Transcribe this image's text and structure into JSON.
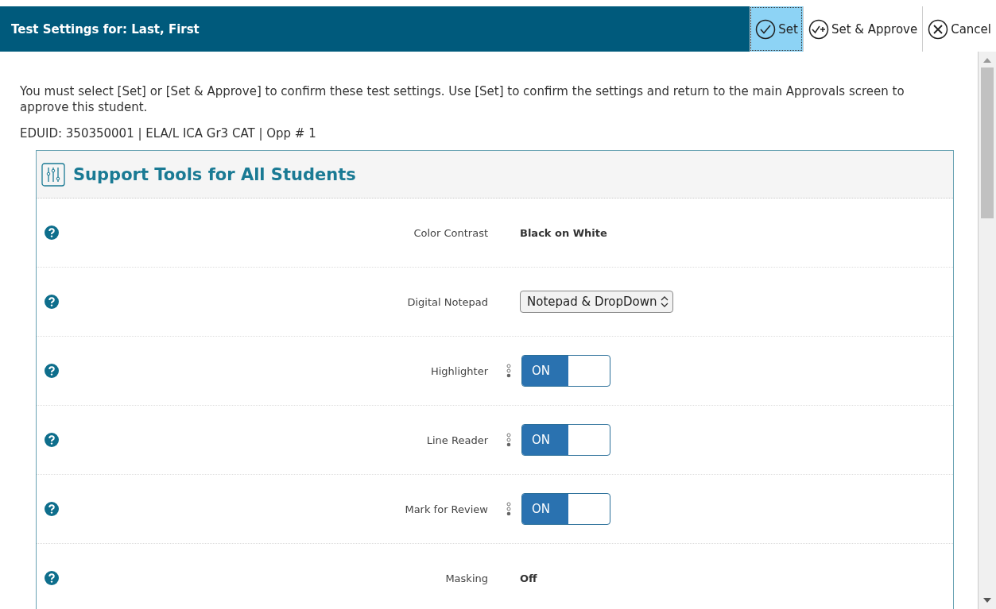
{
  "dialog": {
    "title": "Test Settings for: Last, First",
    "buttons": [
      {
        "kind": "check",
        "label": "Set",
        "selected": true
      },
      {
        "kind": "check-plus",
        "label": "Set & Approve",
        "selected": false
      },
      {
        "kind": "cancel",
        "label": "Cancel",
        "selected": false
      }
    ]
  },
  "instructions": "You must select [Set] or [Set & Approve] to confirm these test settings. Use [Set] to confirm the settings and return to the main Approvals screen to approve this student.",
  "student_info": "EDUID: 350350001 | ELA/L ICA Gr3 CAT | Opp # 1",
  "section": {
    "title": "Support Tools for All Students",
    "rows": [
      {
        "label": "Color Contrast",
        "kind": "text",
        "value": "Black on White"
      },
      {
        "label": "Digital Notepad",
        "kind": "select",
        "value": "Notepad & DropDown"
      },
      {
        "label": "Highlighter",
        "kind": "toggle",
        "on": true,
        "on_label": "ON"
      },
      {
        "label": "Line Reader",
        "kind": "toggle",
        "on": true,
        "on_label": "ON"
      },
      {
        "label": "Mark for Review",
        "kind": "toggle",
        "on": true,
        "on_label": "ON"
      },
      {
        "label": "Masking",
        "kind": "text",
        "value": "Off"
      }
    ]
  }
}
